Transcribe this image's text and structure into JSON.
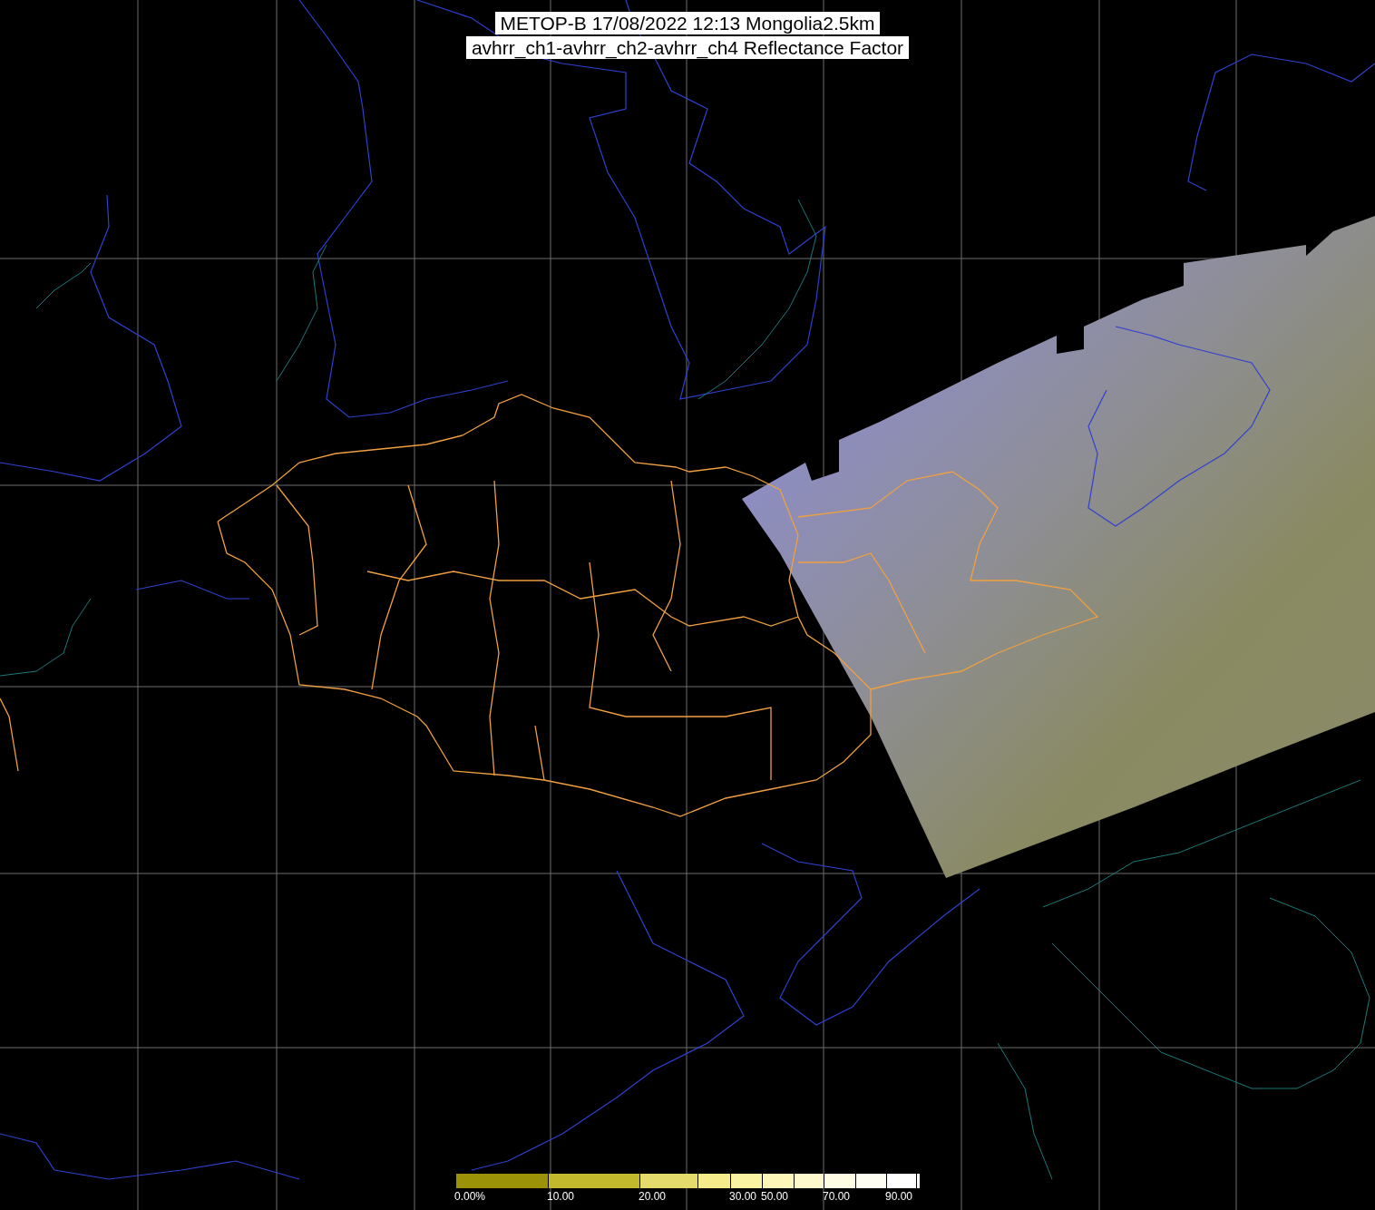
{
  "title": {
    "lines": [
      "METOP-B 17/08/2022 12:13 Mongolia2.5km",
      "avhrr_ch1-avhrr_ch2-avhrr_ch4 Reflectance Factor"
    ]
  },
  "colorbar": {
    "segments": [
      {
        "color": "#9c9208",
        "label": "0.00%"
      },
      {
        "color": "#c2b92c",
        "label": "10.00"
      },
      {
        "color": "#e4da6c",
        "label": "20.00"
      },
      {
        "color": "#f6ec8c"
      },
      {
        "color": "#faf3a2",
        "label": "30.00"
      },
      {
        "color": "#fcf7b8",
        "label": "50.00"
      },
      {
        "color": "#fdf9cc"
      },
      {
        "color": "#fefce2",
        "label": "70.00"
      },
      {
        "color": "#fffef2"
      },
      {
        "color": "#ffffff",
        "label": "90.00"
      },
      {
        "color": "#ffffff"
      }
    ]
  }
}
